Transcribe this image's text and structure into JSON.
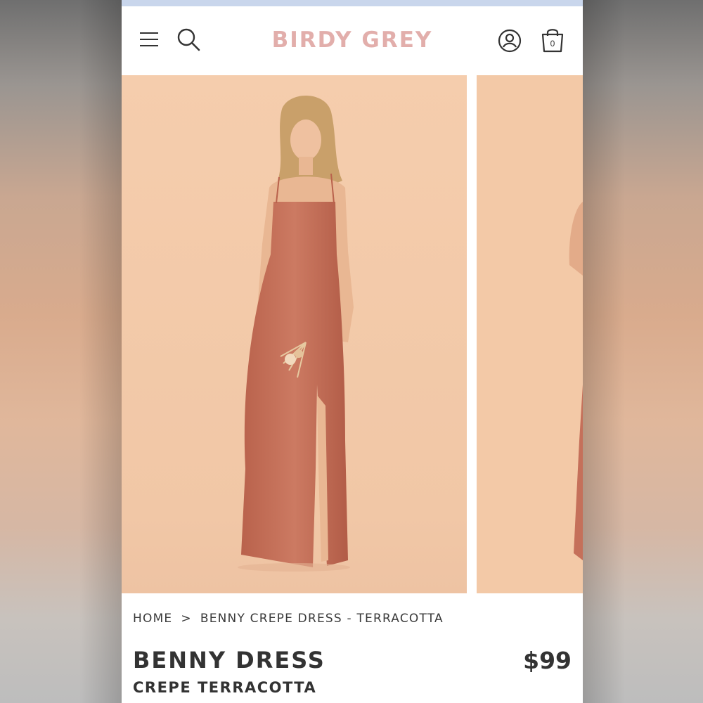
{
  "brand": {
    "logo_text": "BIRDY GREY",
    "logo_color": "#e2aeab"
  },
  "header": {
    "menu_icon": "hamburger-menu-icon",
    "search_icon": "search-icon",
    "account_icon": "user-account-icon",
    "cart_icon": "shopping-bag-icon",
    "cart_count": "0"
  },
  "carousel": {
    "slides": [
      {
        "subject": "model-in-terracotta-dress-front"
      },
      {
        "subject": "model-in-terracotta-dress-partial"
      }
    ],
    "background_color": "#f3c9a7",
    "dress_color": "#c5705a"
  },
  "breadcrumb": {
    "home": "HOME",
    "separator": ">",
    "current": "BENNY CREPE DRESS - TERRACOTTA"
  },
  "product": {
    "name": "BENNY DRESS",
    "variant": "CREPE TERRACOTTA",
    "price": "$99"
  }
}
